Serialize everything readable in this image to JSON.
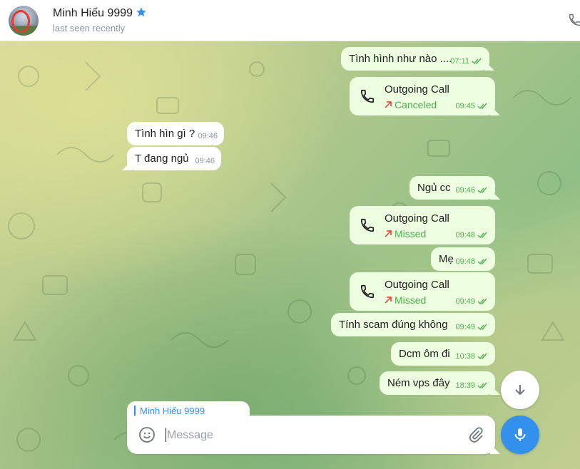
{
  "header": {
    "name": "Minh Hiếu 9999",
    "status": "last seen recently"
  },
  "messages": [
    {
      "dir": "out",
      "type": "text",
      "text": "Tình hình như nào ....",
      "time": "07:11"
    },
    {
      "dir": "out",
      "type": "call",
      "title": "Outgoing Call",
      "sub": "Canceled",
      "time": "09:45"
    },
    {
      "dir": "in",
      "type": "text",
      "text": "Tình hìn gì ?",
      "time": "09:46"
    },
    {
      "dir": "in",
      "type": "text",
      "text": "T đang ngủ",
      "time": "09:46"
    },
    {
      "dir": "out",
      "type": "text",
      "text": "Ngủ cc",
      "time": "09:46"
    },
    {
      "dir": "out",
      "type": "call",
      "title": "Outgoing Call",
      "sub": "Missed",
      "time": "09:48"
    },
    {
      "dir": "out",
      "type": "text",
      "text": "Mẹ",
      "time": "09:48"
    },
    {
      "dir": "out",
      "type": "call",
      "title": "Outgoing Call",
      "sub": "Missed",
      "time": "09:49"
    },
    {
      "dir": "out",
      "type": "text",
      "text": "Tính scam đúng không",
      "time": "09:49"
    },
    {
      "dir": "out",
      "type": "text",
      "text": "Dcm ôm đi",
      "time": "10:38"
    },
    {
      "dir": "out",
      "type": "text",
      "text": "Ném vps đây",
      "time": "18:39"
    }
  ],
  "preview": {
    "label": "Minh Hiếu 9999"
  },
  "composer": {
    "placeholder": "Message"
  },
  "colors": {
    "accent": "#3390ec",
    "outgoing_bubble": "#eefee0",
    "read_check": "#4fae4e",
    "call_arrow": "#e53935"
  }
}
